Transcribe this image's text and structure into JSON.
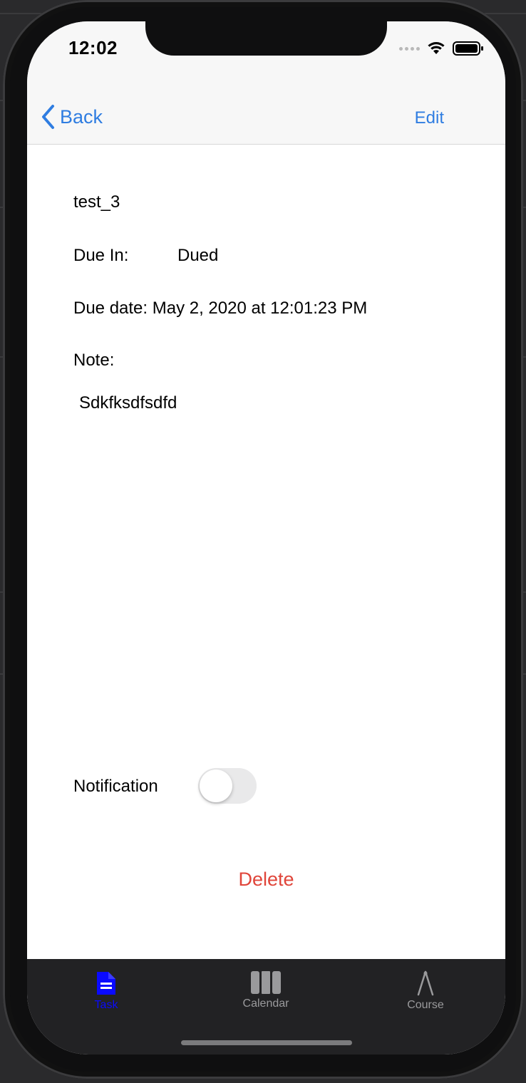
{
  "status_bar": {
    "time": "12:02"
  },
  "nav": {
    "back_label": "Back",
    "edit_label": "Edit"
  },
  "task": {
    "title": "test_3",
    "due_in_label": "Due In:",
    "due_in_value": "Dued",
    "due_date_text": "Due date: May 2, 2020 at 12:01:23 PM",
    "note_label": "Note:",
    "note_text": "Sdkfksdfsdfd"
  },
  "notification": {
    "label": "Notification",
    "enabled": false
  },
  "delete_label": "Delete",
  "tab_bar": {
    "tabs": [
      {
        "label": "Task",
        "icon": "document-icon",
        "selected": true
      },
      {
        "label": "Calendar",
        "icon": "calendar-columns-icon",
        "selected": false
      },
      {
        "label": "Course",
        "icon": "compass-icon",
        "selected": false
      }
    ]
  },
  "colors": {
    "accent": "#2f7de1",
    "destructive": "#e0453a",
    "tab_selected": "#0a0aff",
    "tab_unselected": "#9a9a9c"
  }
}
